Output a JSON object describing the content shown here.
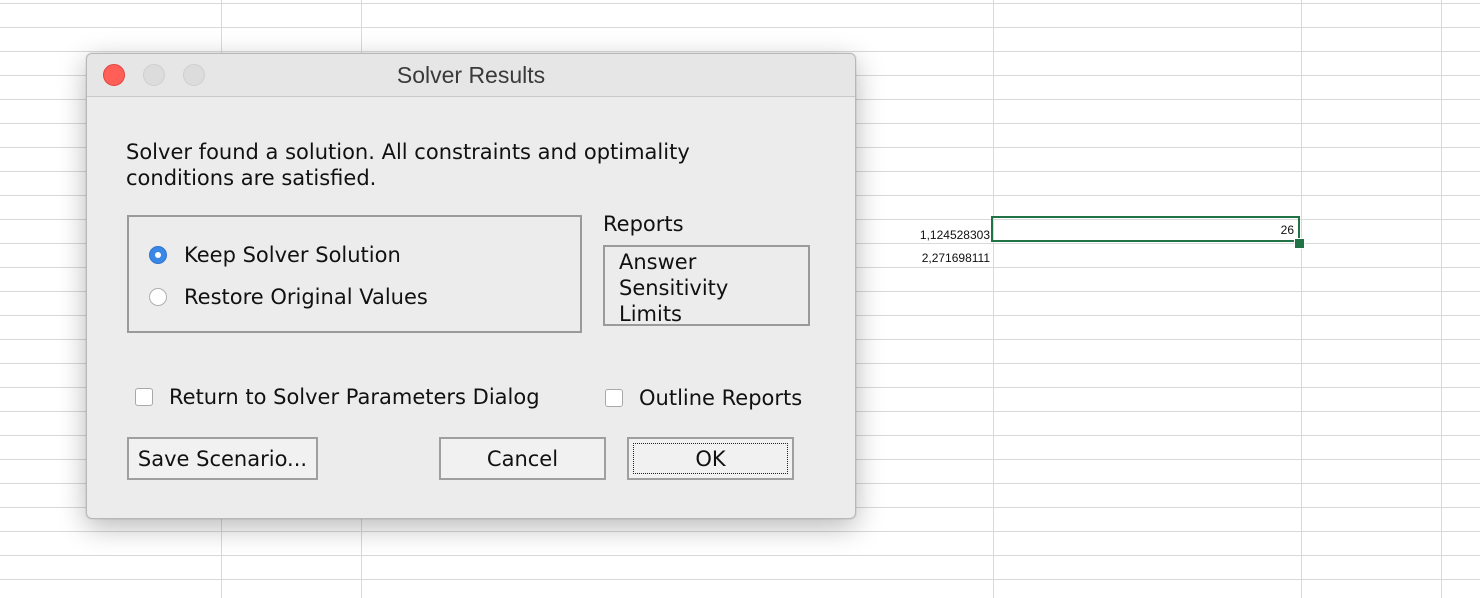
{
  "spreadsheet": {
    "cells": [
      {
        "value": "1,124528303"
      },
      {
        "value": "2,271698111"
      }
    ],
    "selected_cell_value": "26",
    "selection_color": "#217346"
  },
  "dialog": {
    "title": "Solver Results",
    "message": "Solver found a solution.  All constraints and optimality conditions are satisfied.",
    "options": [
      {
        "label": "Keep Solver Solution",
        "selected": true
      },
      {
        "label": "Restore Original Values",
        "selected": false
      }
    ],
    "reports": {
      "label": "Reports",
      "items": [
        "Answer",
        "Sensitivity",
        "Limits"
      ]
    },
    "return_to_params": {
      "label": "Return to Solver Parameters Dialog",
      "checked": false
    },
    "outline_reports": {
      "label": "Outline Reports",
      "checked": false
    },
    "buttons": {
      "save_scenario": "Save Scenario...",
      "cancel": "Cancel",
      "ok": "OK"
    },
    "colors": {
      "close": "#ff5f57",
      "radio_selected": "#3b87e8"
    }
  }
}
